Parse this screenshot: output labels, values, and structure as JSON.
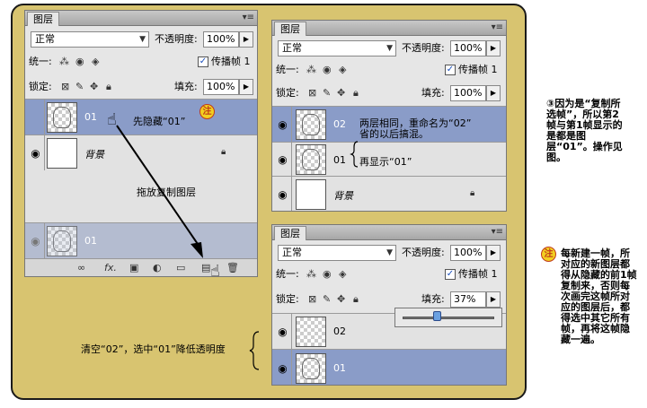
{
  "panel_title": "图层",
  "menu_icon": "menu-icon",
  "blend_mode": "正常",
  "opacity_label": "不透明度:",
  "opacity_value": "100%",
  "unify_label": "统一:",
  "propagate_label": "传播帧 1",
  "lock_label": "锁定:",
  "fill_label": "填充:",
  "fill_value": "100%",
  "fill_value_37": "37%",
  "layer_01": "01",
  "layer_02": "02",
  "layer_bg": "背景",
  "badge_text": "注",
  "ann_hide": "先隐藏“01”",
  "ann_drag": "拖放复制图层",
  "ann_rename": "两层相同，重命名为“02”",
  "ann_rename2": "省的以后搞混。",
  "ann_show": "再显示“01”",
  "ann_clear": "清空“02”，选中“01”降低透明度",
  "note_3": "③因为是“复制所选帧”，所以第2帧与第1帧显示的是都是图层“01”。操作见图。",
  "note_right": "每新建一帧，所对应的新图层都得从隐藏的前1帧复制来，否则每次画完这帧所对应的图层后，都得选中其它所有帧，再将这帧隐藏一遍。",
  "colors": {
    "board": "#d8c470",
    "selected_layer": "#8a9cc8",
    "badge": "#f2d020"
  }
}
